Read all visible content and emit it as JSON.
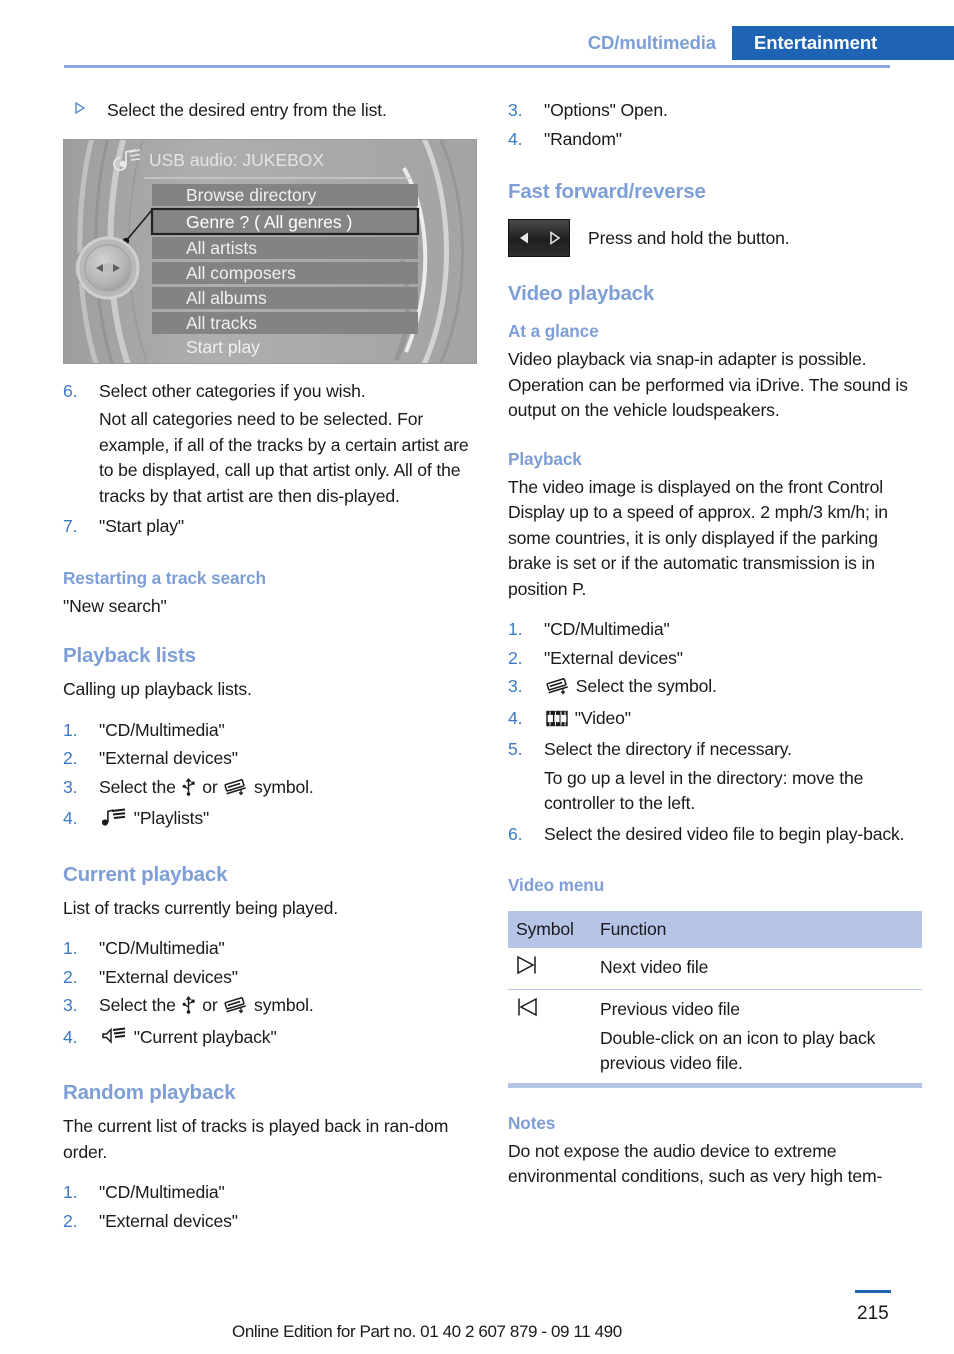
{
  "header": {
    "breadcrumb": "CD/multimedia",
    "chapter": "Entertainment"
  },
  "left_column": {
    "intro_bullet": "Select the desired entry from the list.",
    "idrive_screenshot": {
      "title": "USB audio: JUKEBOX",
      "title_icon": "usb-audio-icon",
      "menu_items": [
        "Browse directory",
        "Genre ? ( All genres )",
        "All artists",
        "All composers",
        "All albums",
        "All tracks",
        "Start play"
      ],
      "highlighted_item": "Genre ? ( All genres )",
      "controller_icon": "idrive-controller-knob"
    },
    "steps_6_7": [
      {
        "num": "6.",
        "text": "Select other categories if you wish."
      },
      {
        "num": "7.",
        "text": "\"Start play\""
      }
    ],
    "step6_note": "Not all categories need to be selected. For example, if all of the tracks by a certain artist are to be displayed, call up that artist only. All of the tracks by that artist are then dis-played.",
    "restarting": {
      "heading": "Restarting a track search",
      "text": "\"New search\""
    },
    "playback_lists": {
      "heading": "Playback lists",
      "intro": "Calling up playback lists.",
      "steps": [
        {
          "num": "1.",
          "text": "\"CD/Multimedia\""
        },
        {
          "num": "2.",
          "text": "\"External devices\""
        },
        {
          "num": "3.",
          "text_before": "Select the ",
          "icon1": "usb-symbol",
          "text_mid": " or ",
          "icon2": "snap-in-adapter-symbol",
          "text_after": " symbol."
        },
        {
          "num": "4.",
          "icon": "playlists-symbol",
          "text": "\"Playlists\""
        }
      ]
    },
    "current_playback": {
      "heading": "Current playback",
      "intro": "List of tracks currently being played.",
      "steps": [
        {
          "num": "1.",
          "text": "\"CD/Multimedia\""
        },
        {
          "num": "2.",
          "text": "\"External devices\""
        },
        {
          "num": "3.",
          "text_before": "Select the ",
          "icon1": "usb-symbol",
          "text_mid": " or ",
          "icon2": "snap-in-adapter-symbol",
          "text_after": " symbol."
        },
        {
          "num": "4.",
          "icon": "current-playback-symbol",
          "text": "\"Current playback\""
        }
      ]
    },
    "random_playback": {
      "heading": "Random playback",
      "intro": "The current list of tracks is played back in ran-dom order.",
      "steps": [
        {
          "num": "1.",
          "text": "\"CD/Multimedia\""
        },
        {
          "num": "2.",
          "text": "\"External devices\""
        }
      ]
    }
  },
  "right_column": {
    "random_steps_cont": [
      {
        "num": "3.",
        "text": "\"Options\" Open."
      },
      {
        "num": "4.",
        "text": "\"Random\""
      }
    ],
    "fast_forward": {
      "heading": "Fast forward/reverse",
      "button_icon": "rewind-forward-button",
      "text": "Press and hold the button."
    },
    "video_playback": {
      "heading": "Video playback",
      "at_a_glance": {
        "heading": "At a glance",
        "text": "Video playback via snap-in adapter is possible. Operation can be performed via iDrive. The sound is output on the vehicle loudspeakers."
      },
      "playback": {
        "heading": "Playback",
        "text": "The video image is displayed on the front Control Display up to a speed of approx. 2 mph/3 km/h; in some countries, it is only displayed if the parking brake is set or if the automatic transmission is in position P.",
        "steps": [
          {
            "num": "1.",
            "text": "\"CD/Multimedia\""
          },
          {
            "num": "2.",
            "text": "\"External devices\""
          },
          {
            "num": "3.",
            "icon": "snap-in-adapter-symbol",
            "text": "Select the symbol."
          },
          {
            "num": "4.",
            "icon": "video-film-symbol",
            "text": "\"Video\""
          },
          {
            "num": "5.",
            "text": "Select the directory if necessary."
          },
          {
            "num": "6.",
            "text": "Select the desired video file to begin play-back."
          }
        ],
        "step5_note": "To go up a level in the directory: move the controller to the left."
      },
      "video_menu": {
        "heading": "Video menu",
        "columns": [
          "Symbol",
          "Function"
        ],
        "rows": [
          {
            "icon": "next-video-icon",
            "function": "Next video file",
            "note": ""
          },
          {
            "icon": "previous-video-icon",
            "function": "Previous video file",
            "note": "Double-click on an icon to play back previous video file."
          }
        ]
      }
    },
    "notes": {
      "heading": "Notes",
      "text": "Do not expose the audio device to extreme environmental conditions, such as very high tem-"
    }
  },
  "footer": {
    "text": "Online Edition for Part no. 01 40 2 607 879 - 09 11 490",
    "page_number": "215"
  },
  "colors": {
    "accent_blue": "#1e63b4",
    "heading_blue": "#7d9ed6",
    "number_blue": "#3b7ac4",
    "table_header": "#b6c4e8",
    "rule_blue": "#8aa8dd"
  }
}
